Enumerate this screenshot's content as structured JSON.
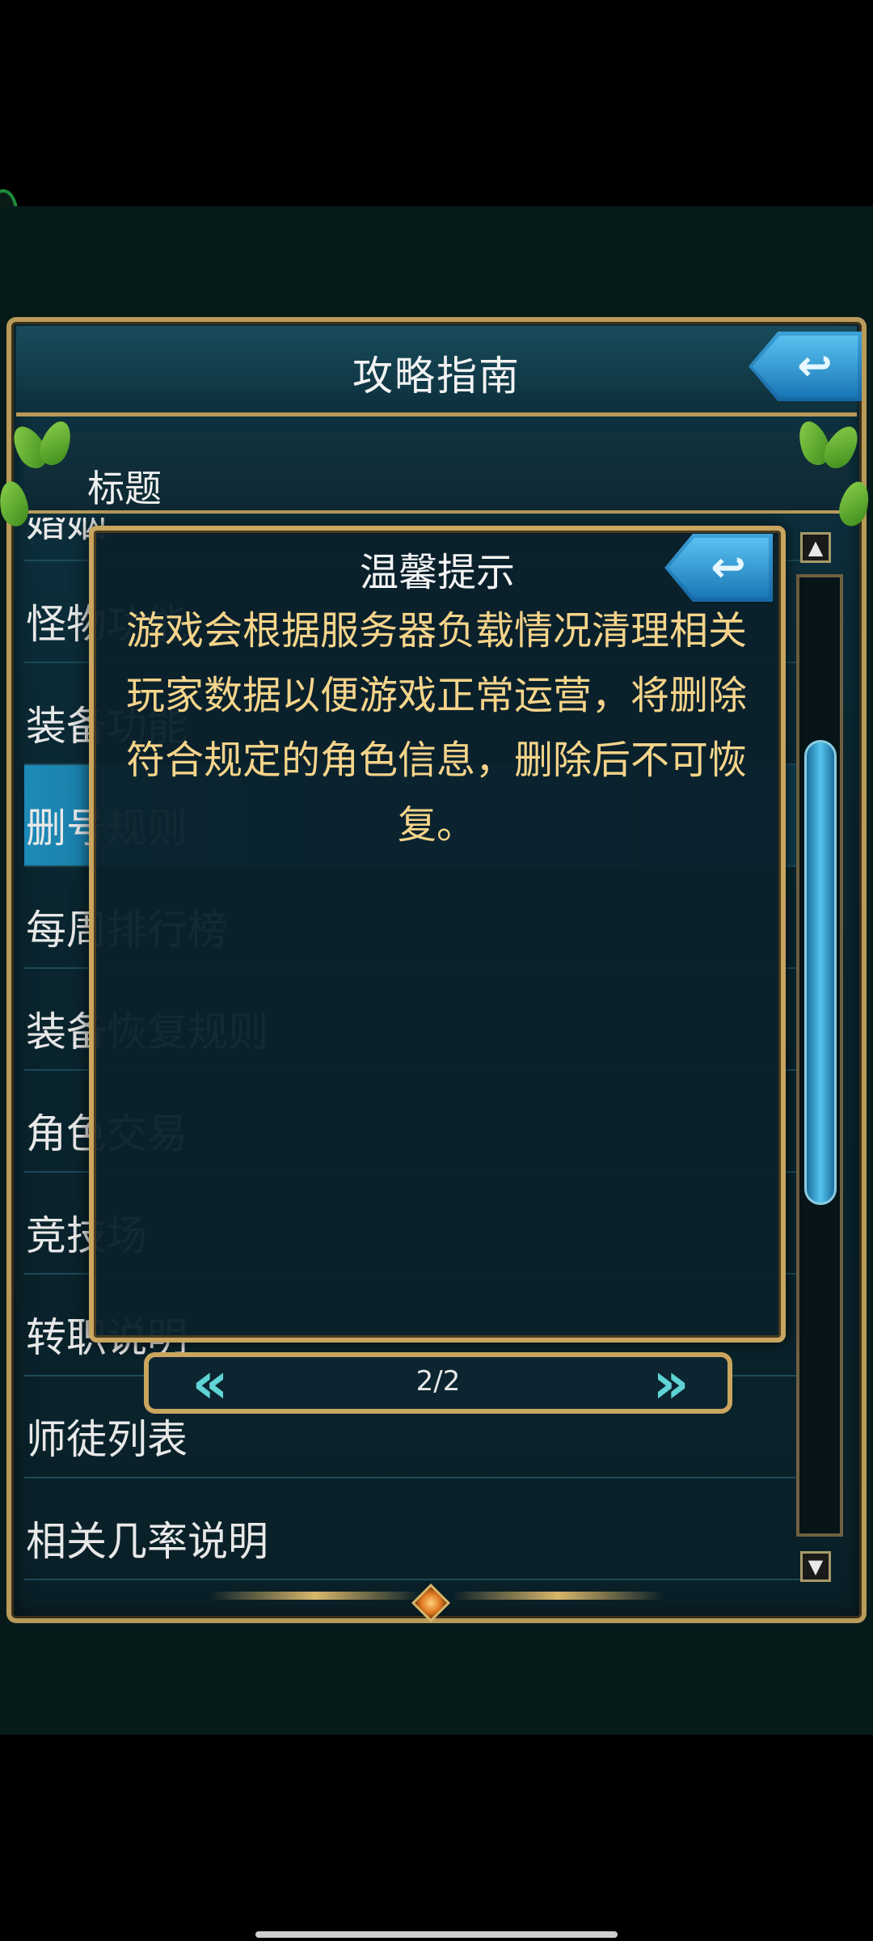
{
  "window": {
    "title": "攻略指南"
  },
  "table": {
    "header": "标题"
  },
  "list": {
    "items": [
      {
        "label": "婚姻"
      },
      {
        "label": "怪物功能"
      },
      {
        "label": "装备功能"
      },
      {
        "label": "删号规则"
      },
      {
        "label": "每周排行榜"
      },
      {
        "label": "装备恢复规则"
      },
      {
        "label": "角色交易"
      },
      {
        "label": "竞技场"
      },
      {
        "label": "转职说明"
      },
      {
        "label": "师徒列表"
      },
      {
        "label": "相关几率说明"
      }
    ],
    "selected_index": 3
  },
  "dialog": {
    "title": "温馨提示",
    "message": "游戏会根据服务器负载情况清理相关玩家数据以便游戏正常运营，将删除符合规定的角色信息，删除后不可恢复。"
  },
  "pager": {
    "text": "2/2"
  },
  "icons": {
    "back": "back-arrow-icon",
    "prev": "double-left-arrow-icon",
    "next": "double-right-arrow-icon",
    "scroll_up": "triangle-up-icon",
    "scroll_down": "triangle-down-icon"
  },
  "colors": {
    "frame_gold": "#b89a5a",
    "accent_blue": "#1d8ab8",
    "message_text": "#f5d48a"
  }
}
